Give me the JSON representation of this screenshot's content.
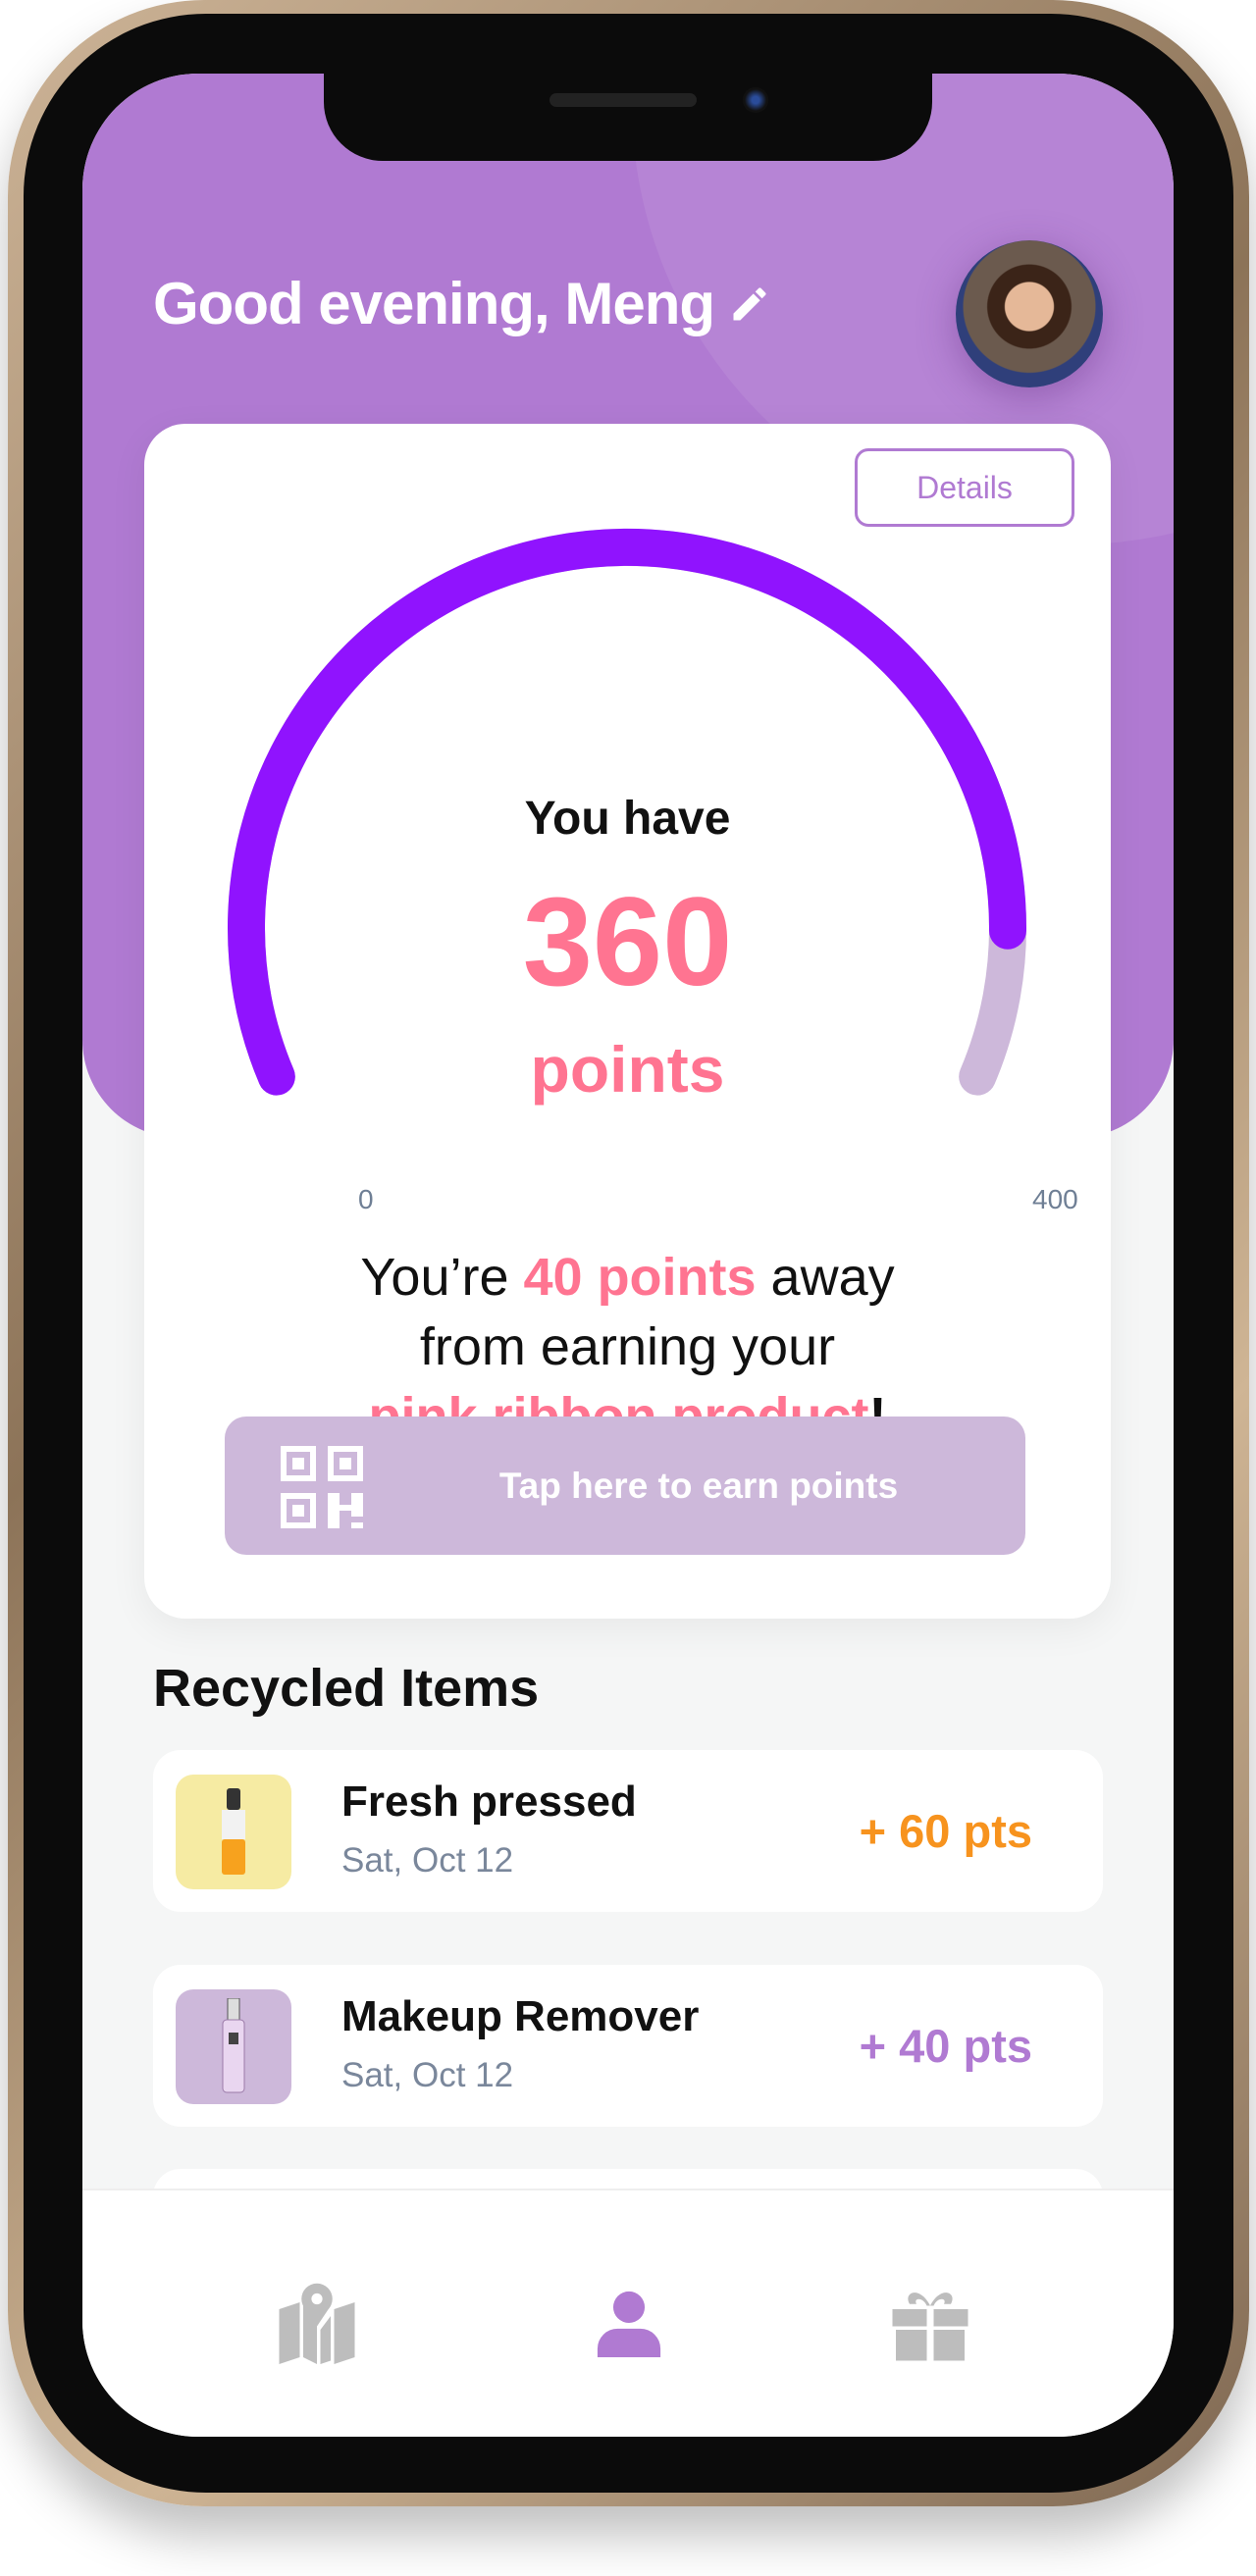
{
  "header": {
    "greeting": "Good evening, Meng"
  },
  "card": {
    "details_label": "Details",
    "you_have": "You have",
    "points": "360",
    "points_word": "points",
    "gauge": {
      "value": 360,
      "min": 0,
      "max": 400,
      "min_label": "0",
      "max_label": "400",
      "fill_color": "#9013fe",
      "track_color": "#cdb8da"
    },
    "message": {
      "pre": "You’re ",
      "highlight1": "40 points",
      "mid1": " away",
      "line2": "from earning your",
      "highlight2": "pink ribbon product",
      "end": "!"
    },
    "tap_label": "Tap here to earn points"
  },
  "recycled": {
    "title": "Recycled Items",
    "items": [
      {
        "name": "Fresh pressed",
        "date": "Sat, Oct 12",
        "points": "+ 60 pts",
        "color": "#f7931e",
        "thumb_bg": "#f6eba3"
      },
      {
        "name": "Makeup Remover",
        "date": "Sat, Oct 12",
        "points": "+ 40 pts",
        "color": "#b07ad2",
        "thumb_bg": "#cdb8da"
      }
    ]
  },
  "tabs": [
    {
      "name": "map-icon",
      "active": false
    },
    {
      "name": "profile-icon",
      "active": true
    },
    {
      "name": "gift-icon",
      "active": false
    }
  ]
}
